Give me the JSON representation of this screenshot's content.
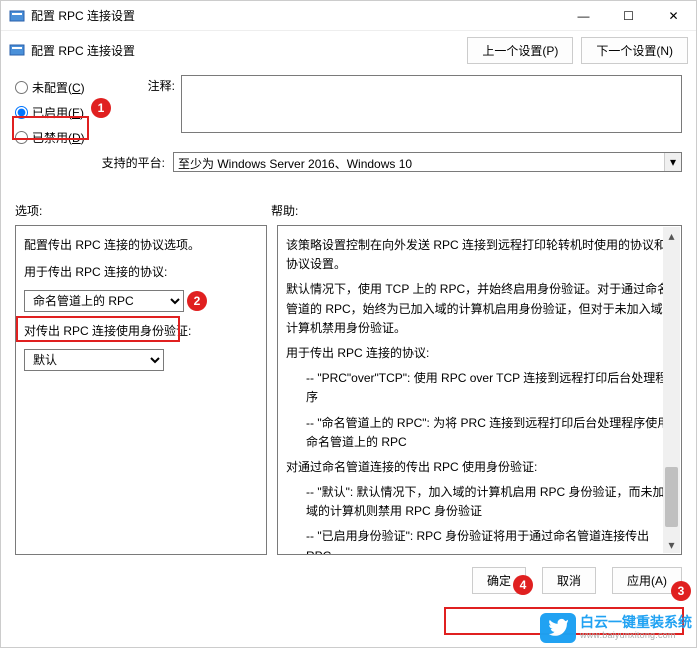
{
  "window": {
    "title": "配置 RPC 连接设置",
    "minimize": "—",
    "maximize": "☐",
    "close": "✕"
  },
  "toolbar": {
    "title": "配置 RPC 连接设置",
    "prev": "上一个设置(P)",
    "next": "下一个设置(N)"
  },
  "state": {
    "not_configured": "未配置(C)",
    "enabled": "已启用(E)",
    "disabled": "已禁用(D)"
  },
  "comment": {
    "label": "注释:",
    "value": ""
  },
  "platform": {
    "label": "支持的平台:",
    "value": "至少为 Windows Server 2016、Windows 10"
  },
  "sections": {
    "options": "选项:",
    "help": "帮助:"
  },
  "options": {
    "line1": "配置传出 RPC 连接的协议选项。",
    "protocol_label": "用于传出 RPC 连接的协议:",
    "protocol_value": "命名管道上的 RPC",
    "auth_label": "对传出 RPC 连接使用身份验证:",
    "auth_value": "默认"
  },
  "help": {
    "p1": "该策略设置控制在向外发送 RPC 连接到远程打印轮转机时使用的协议和协议设置。",
    "p2": "默认情况下，使用 TCP 上的 RPC，并始终启用身份验证。对于通过命名管道的 RPC，始终为已加入域的计算机启用身份验证，但对于未加入域的计算机禁用身份验证。",
    "p3": "用于传出 RPC 连接的协议:",
    "p3a": "-- \"PRC\"over\"TCP\": 使用 RPC over TCP 连接到远程打印后台处理程序",
    "p3b": "-- \"命名管道上的 RPC\": 为将 PRC 连接到远程打印后台处理程序使用命名管道上的 RPC",
    "p4": "对通过命名管道连接的传出 RPC 使用身份验证:",
    "p4a": "-- \"默认\": 默认情况下，加入域的计算机启用 RPC 身份验证，而未加入域的计算机则禁用 RPC 身份验证",
    "p4b": "-- \"已启用身份验证\": RPC 身份验证将用于通过命名管道连接传出 RPC"
  },
  "footer": {
    "ok": "确定",
    "cancel": "取消",
    "apply": "应用(A)"
  },
  "watermark": {
    "line1": "白云一键重装系统",
    "line2": "www.baiyunxitong.com"
  },
  "annotations": {
    "n1": "1",
    "n2": "2",
    "n3": "3",
    "n4": "4"
  }
}
